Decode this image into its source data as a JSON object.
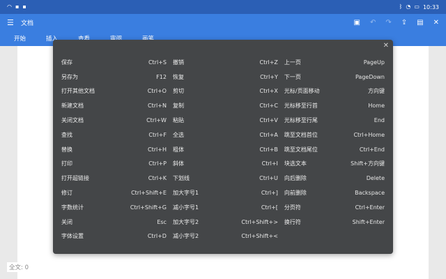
{
  "statusbar": {
    "time": "10:33"
  },
  "titlebar": {
    "title": "文档"
  },
  "tabs": [
    "开始",
    "插入",
    "查看",
    "审阅",
    "画笔"
  ],
  "footer": {
    "word_count": "全文: 0"
  },
  "shortcuts": {
    "col1": [
      {
        "label": "保存",
        "key": "Ctrl+S"
      },
      {
        "label": "另存为",
        "key": "F12"
      },
      {
        "label": "打开其他文档",
        "key": "Ctrl+O"
      },
      {
        "label": "新建文档",
        "key": "Ctrl+N"
      },
      {
        "label": "关闭文档",
        "key": "Ctrl+W"
      },
      {
        "label": "查找",
        "key": "Ctrl+F"
      },
      {
        "label": "替换",
        "key": "Ctrl+H"
      },
      {
        "label": "打印",
        "key": "Ctrl+P"
      },
      {
        "label": "打开超链接",
        "key": "Ctrl+K"
      },
      {
        "label": "修订",
        "key": "Ctrl+Shift+E"
      },
      {
        "label": "字数统计",
        "key": "Ctrl+Shift+G"
      },
      {
        "label": "关闭",
        "key": "Esc"
      },
      {
        "label": "字体设置",
        "key": "Ctrl+D"
      }
    ],
    "col2": [
      {
        "label": "撤销",
        "key": "Ctrl+Z"
      },
      {
        "label": "恢复",
        "key": "Ctrl+Y"
      },
      {
        "label": "剪切",
        "key": "Ctrl+X"
      },
      {
        "label": "复制",
        "key": "Ctrl+C"
      },
      {
        "label": "粘贴",
        "key": "Ctrl+V"
      },
      {
        "label": "全选",
        "key": "Ctrl+A"
      },
      {
        "label": "粗体",
        "key": "Ctrl+B"
      },
      {
        "label": "斜体",
        "key": "Ctrl+I"
      },
      {
        "label": "下划线",
        "key": "Ctrl+U"
      },
      {
        "label": "加大字号1",
        "key": "Ctrl+]"
      },
      {
        "label": "减小字号1",
        "key": "Ctrl+["
      },
      {
        "label": "加大字号2",
        "key": "Ctrl+Shift+>"
      },
      {
        "label": "减小字号2",
        "key": "Ctrl+Shift+<"
      }
    ],
    "col3": [
      {
        "label": "上一页",
        "key": "PageUp"
      },
      {
        "label": "下一页",
        "key": "PageDown"
      },
      {
        "label": "光标/页面移动",
        "key": "方向键"
      },
      {
        "label": "光标移至行首",
        "key": "Home"
      },
      {
        "label": "光标移至行尾",
        "key": "End"
      },
      {
        "label": "跳至文档首位",
        "key": "Ctrl+Home"
      },
      {
        "label": "跳至文档尾位",
        "key": "Ctrl+End"
      },
      {
        "label": "块选文本",
        "key": "Shift+方向键"
      },
      {
        "label": "向后删除",
        "key": "Delete"
      },
      {
        "label": "向前删除",
        "key": "Backspace"
      },
      {
        "label": "分页符",
        "key": "Ctrl+Enter"
      },
      {
        "label": "换行符",
        "key": "Shift+Enter"
      }
    ]
  },
  "icons": {
    "wifi": "wifi-icon",
    "close": "close-icon"
  }
}
